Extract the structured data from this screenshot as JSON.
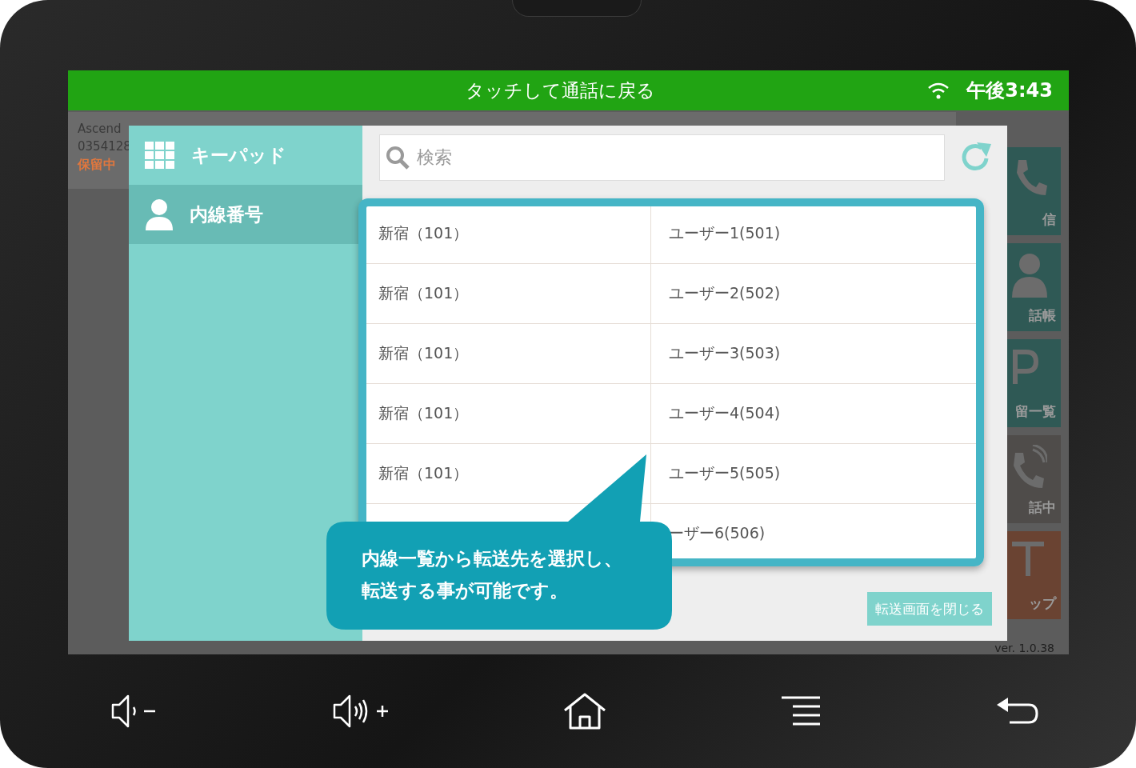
{
  "status_bar": {
    "title": "タッチして通話に戻る",
    "time": "午後3:43"
  },
  "background_app": {
    "caller_name": "Ascend",
    "caller_number": "0354128",
    "call_state": "保留中",
    "tiles": [
      {
        "label": "信",
        "kind": "dial"
      },
      {
        "label": "話帳",
        "kind": "contacts"
      },
      {
        "label": "留一覧",
        "kind": "hold"
      },
      {
        "label": "話中",
        "kind": "calling"
      },
      {
        "label": "ップ",
        "kind": "setup"
      }
    ],
    "version": "ver. 1.0.38"
  },
  "dialog": {
    "menu": [
      {
        "label": "キーパッド",
        "kind": "keypad",
        "selected": false
      },
      {
        "label": "内線番号",
        "kind": "extension",
        "selected": true
      }
    ],
    "search": {
      "placeholder": "検索"
    },
    "rows": [
      {
        "group": "新宿（101）",
        "user": "ユーザー1(501)"
      },
      {
        "group": "新宿（101）",
        "user": "ユーザー2(502)"
      },
      {
        "group": "新宿（101）",
        "user": "ユーザー3(503)"
      },
      {
        "group": "新宿（101）",
        "user": "ユーザー4(504)"
      },
      {
        "group": "新宿（101）",
        "user": "ユーザー5(505)"
      },
      {
        "user": "ーザー6(506)"
      }
    ],
    "close_button": "転送画面を閉じる"
  },
  "callout": {
    "lines": [
      "内線一覧から転送先を選択し、",
      "転送する事が可能です。"
    ]
  }
}
